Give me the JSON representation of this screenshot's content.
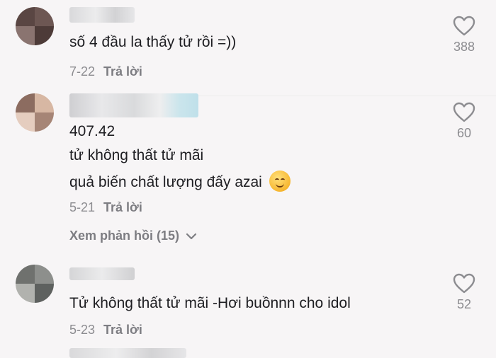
{
  "comments": [
    {
      "lines": [
        "số 4 đầu la thấy tử rồi =))"
      ],
      "date": "7-22",
      "reply_label": "Trả lời",
      "likes": "388"
    },
    {
      "lines": [
        "407.42",
        "tử không thất tử mãi",
        "quả biến chất lượng đấy azai"
      ],
      "date": "5-21",
      "reply_label": "Trả lời",
      "likes": "60",
      "view_replies": "Xem phản hồi (15)"
    },
    {
      "lines": [
        "Tử không thất tử mãi -Hơi buồnnn cho idol"
      ],
      "date": "5-23",
      "reply_label": "Trả lời",
      "likes": "52"
    }
  ],
  "colors": {
    "background": "#f7f5f6",
    "text": "#1e1e22",
    "muted": "#8c8c90"
  }
}
